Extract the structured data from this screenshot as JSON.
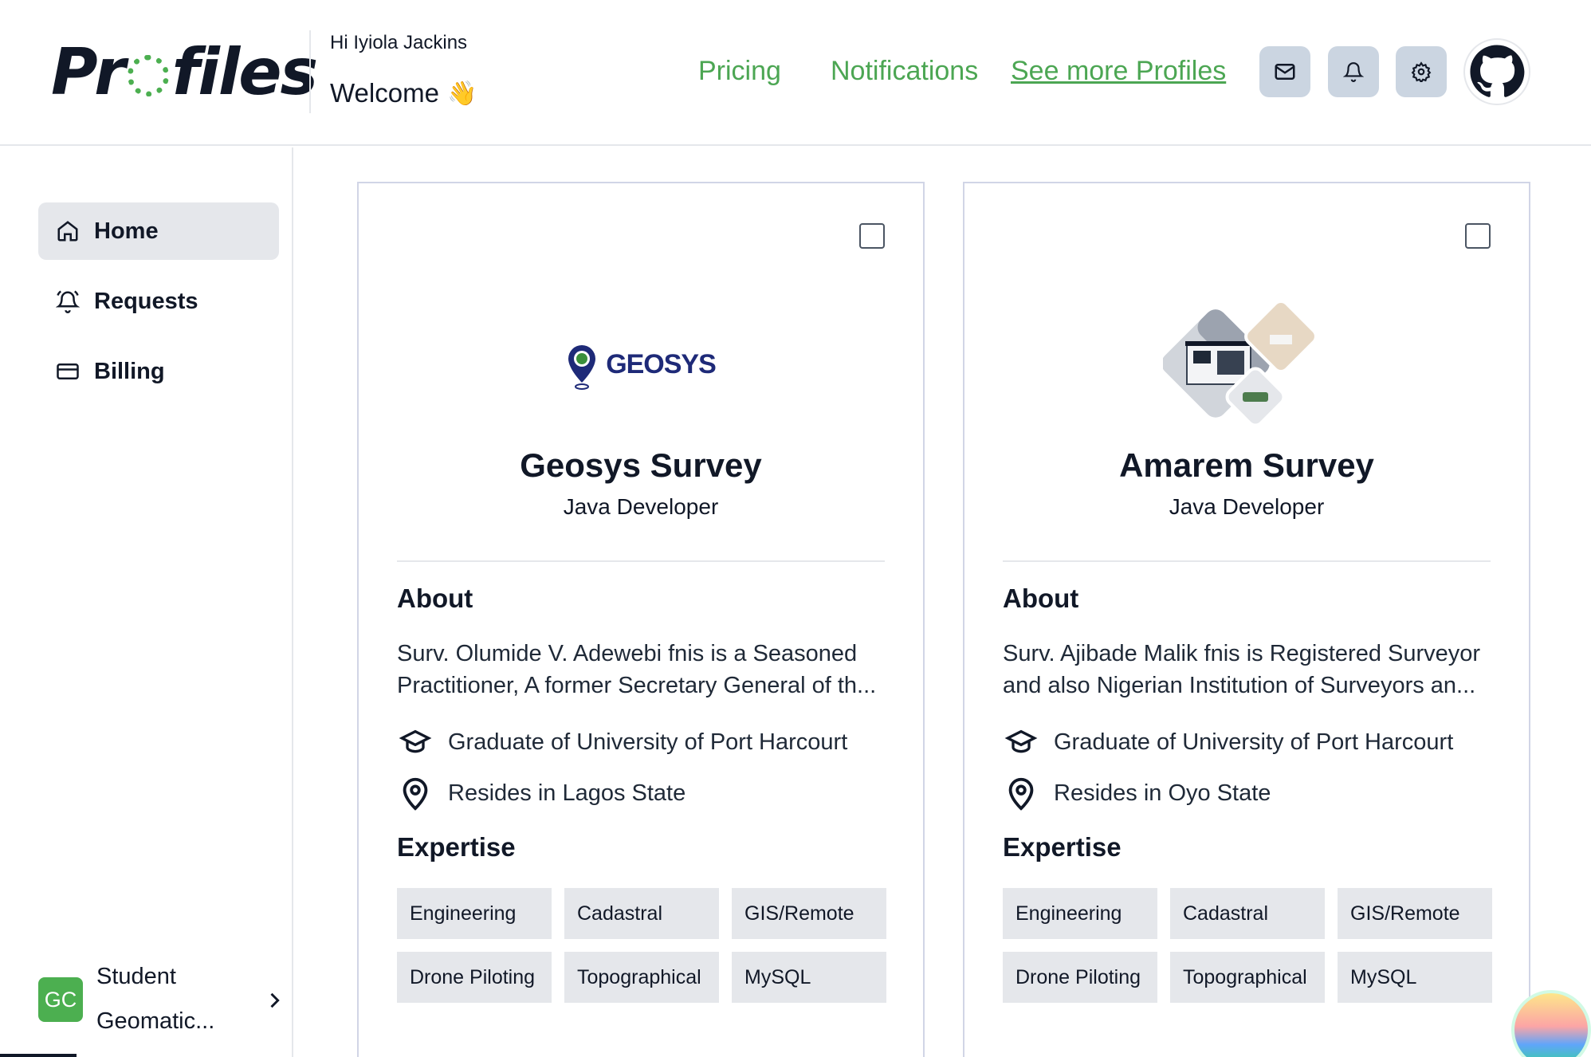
{
  "header": {
    "logo_text_pre": "Pr",
    "logo_text_post": "files",
    "greeting": "Hi Iyiola Jackins",
    "welcome": "Welcome",
    "welcome_emoji": "👋",
    "nav": {
      "pricing": "Pricing",
      "notifications": "Notifications",
      "see_more": "See more Profiles"
    },
    "icons": [
      "mail-icon",
      "bell-icon",
      "gear-icon",
      "github-icon"
    ]
  },
  "sidebar": {
    "items": [
      {
        "label": "Home",
        "icon": "home-icon",
        "active": true
      },
      {
        "label": "Requests",
        "icon": "bell-ring-icon",
        "active": false
      },
      {
        "label": "Billing",
        "icon": "credit-card-icon",
        "active": false
      }
    ],
    "user": {
      "initials": "GC",
      "line1": "Student",
      "line2": "Geomatic..."
    }
  },
  "cards": [
    {
      "logo_text": "GEOSYS",
      "title": "Geosys Survey",
      "role": "Java Developer",
      "about_heading": "About",
      "about": "Surv. Olumide V. Adewebi fnis is a Seasoned Practitioner, A former Secretary General of th...",
      "education": "Graduate of University of Port Harcourt",
      "location": "Resides in Lagos State",
      "expertise_heading": "Expertise",
      "expertise": [
        "Engineering",
        "Cadastral",
        "GIS/Remote",
        "Drone Piloting",
        "Topographical",
        "MySQL"
      ]
    },
    {
      "logo_text": "",
      "title": "Amarem Survey",
      "role": "Java Developer",
      "about_heading": "About",
      "about": "Surv. Ajibade Malik fnis is Registered Surveyor and also Nigerian Institution of Surveyors an...",
      "education": "Graduate of University of Port Harcourt",
      "location": "Resides in Oyo State",
      "expertise_heading": "Expertise",
      "expertise": [
        "Engineering",
        "Cadastral",
        "GIS/Remote",
        "Drone Piloting",
        "Topographical",
        "MySQL"
      ]
    }
  ],
  "colors": {
    "accent": "#4caf50",
    "icon_button_bg": "#cbd5e1",
    "chip_bg": "#e5e7eb",
    "card_border": "#d1d5e6"
  }
}
